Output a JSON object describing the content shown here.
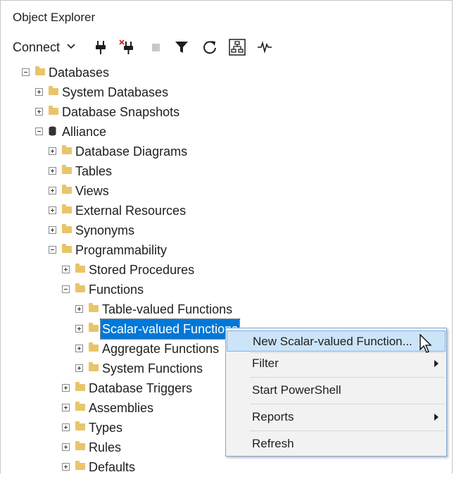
{
  "window": {
    "title": "Object Explorer"
  },
  "toolbar": {
    "connect_label": "Connect",
    "icons": [
      "connect-plug-icon",
      "disconnect-icon",
      "stop-icon",
      "filter-icon",
      "refresh-icon",
      "schema-icon",
      "activity-monitor-icon"
    ]
  },
  "tree": {
    "databases": "Databases",
    "system_databases": "System Databases",
    "database_snapshots": "Database Snapshots",
    "alliance": "Alliance",
    "database_diagrams": "Database Diagrams",
    "tables": "Tables",
    "views": "Views",
    "external_resources": "External Resources",
    "synonyms": "Synonyms",
    "programmability": "Programmability",
    "stored_procedures": "Stored Procedures",
    "functions": "Functions",
    "table_valued_functions": "Table-valued Functions",
    "scalar_valued_functions": "Scalar-valued Functions",
    "aggregate_functions": "Aggregate Functions",
    "system_functions": "System Functions",
    "database_triggers": "Database Triggers",
    "assemblies": "Assemblies",
    "types": "Types",
    "rules": "Rules",
    "defaults": "Defaults"
  },
  "context_menu": {
    "items": [
      {
        "label": "New Scalar-valued Function..."
      },
      {
        "label": "Filter"
      },
      {
        "label": "Start PowerShell"
      },
      {
        "label": "Reports"
      },
      {
        "label": "Refresh"
      }
    ]
  },
  "colors": {
    "selection": "#0078d7",
    "folder": "#e8c56a",
    "menu_hover": "#cce4f7"
  }
}
